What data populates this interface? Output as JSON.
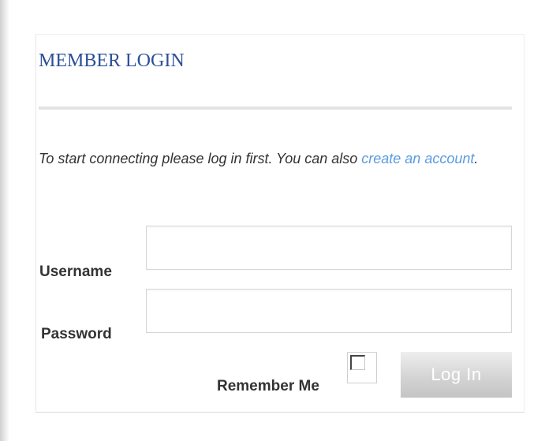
{
  "login": {
    "title": "MEMBER LOGIN",
    "intro_text": "To start connecting please log in first. You can also ",
    "create_account_link": "create an account",
    "intro_suffix": ".",
    "username_label": "Username",
    "username_value": "",
    "password_label": "Password",
    "password_value": "",
    "remember_label": "Remember Me",
    "remember_checked": false,
    "login_button_label": "Log In"
  },
  "colors": {
    "title": "#2b4f98",
    "link": "#5b9be0",
    "button_bg": "#d4d4d4",
    "button_text": "#ffffff"
  }
}
